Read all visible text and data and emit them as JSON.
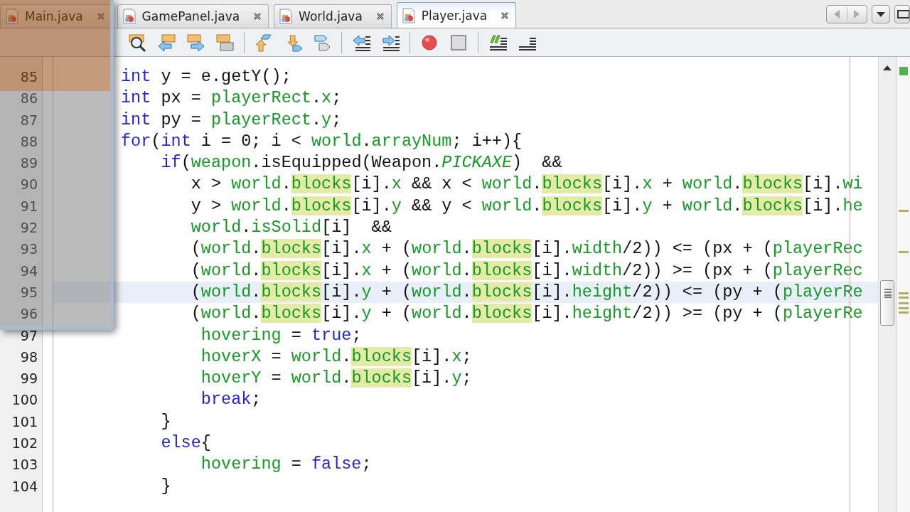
{
  "tabs": [
    {
      "label": "Main.java",
      "selected": false
    },
    {
      "label": "GamePanel.java",
      "selected": false
    },
    {
      "label": "World.java",
      "selected": false
    },
    {
      "label": "Player.java",
      "selected": true
    }
  ],
  "editor": {
    "lines": [
      {
        "number": "85",
        "current": false,
        "tokens": [
          {
            "kind": "keyword",
            "text": "int"
          },
          {
            "kind": "plain",
            "text": " y = e.getY();"
          }
        ]
      },
      {
        "number": "86",
        "current": false,
        "tokens": [
          {
            "kind": "keyword",
            "text": "int"
          },
          {
            "kind": "plain",
            "text": " px = "
          },
          {
            "kind": "field",
            "text": "playerRect"
          },
          {
            "kind": "plain",
            "text": "."
          },
          {
            "kind": "field",
            "text": "x"
          },
          {
            "kind": "plain",
            "text": ";"
          }
        ]
      },
      {
        "number": "87",
        "current": false,
        "tokens": [
          {
            "kind": "keyword",
            "text": "int"
          },
          {
            "kind": "plain",
            "text": " py = "
          },
          {
            "kind": "field",
            "text": "playerRect"
          },
          {
            "kind": "plain",
            "text": "."
          },
          {
            "kind": "field",
            "text": "y"
          },
          {
            "kind": "plain",
            "text": ";"
          }
        ]
      },
      {
        "number": "88",
        "current": false,
        "tokens": [
          {
            "kind": "keyword",
            "text": "for"
          },
          {
            "kind": "plain",
            "text": "("
          },
          {
            "kind": "keyword",
            "text": "int"
          },
          {
            "kind": "plain",
            "text": " i = 0; i < "
          },
          {
            "kind": "field",
            "text": "world"
          },
          {
            "kind": "plain",
            "text": "."
          },
          {
            "kind": "field",
            "text": "arrayNum"
          },
          {
            "kind": "plain",
            "text": "; i++){"
          }
        ]
      },
      {
        "number": "89",
        "current": false,
        "tokens": [
          {
            "kind": "keyword",
            "text": "    if"
          },
          {
            "kind": "plain",
            "text": "("
          },
          {
            "kind": "field",
            "text": "weapon"
          },
          {
            "kind": "plain",
            "text": ".isEquipped(Weapon."
          },
          {
            "kind": "constant",
            "text": "PICKAXE"
          },
          {
            "kind": "plain",
            "text": ")  &&"
          }
        ]
      },
      {
        "number": "90",
        "current": false,
        "tokens": [
          {
            "kind": "plain",
            "text": "       x > "
          },
          {
            "kind": "field",
            "text": "world"
          },
          {
            "kind": "plain",
            "text": "."
          },
          {
            "kind": "occurrence",
            "text": "blocks"
          },
          {
            "kind": "plain",
            "text": "[i]."
          },
          {
            "kind": "field",
            "text": "x"
          },
          {
            "kind": "plain",
            "text": " && x < "
          },
          {
            "kind": "field",
            "text": "world"
          },
          {
            "kind": "plain",
            "text": "."
          },
          {
            "kind": "occurrence",
            "text": "blocks"
          },
          {
            "kind": "plain",
            "text": "[i]."
          },
          {
            "kind": "field",
            "text": "x"
          },
          {
            "kind": "plain",
            "text": " + "
          },
          {
            "kind": "field",
            "text": "world"
          },
          {
            "kind": "plain",
            "text": "."
          },
          {
            "kind": "occurrence",
            "text": "blocks"
          },
          {
            "kind": "plain",
            "text": "[i]."
          },
          {
            "kind": "field",
            "text": "wi"
          }
        ]
      },
      {
        "number": "91",
        "current": false,
        "tokens": [
          {
            "kind": "plain",
            "text": "       y > "
          },
          {
            "kind": "field",
            "text": "world"
          },
          {
            "kind": "plain",
            "text": "."
          },
          {
            "kind": "occurrence",
            "text": "blocks"
          },
          {
            "kind": "plain",
            "text": "[i]."
          },
          {
            "kind": "field",
            "text": "y"
          },
          {
            "kind": "plain",
            "text": " && y < "
          },
          {
            "kind": "field",
            "text": "world"
          },
          {
            "kind": "plain",
            "text": "."
          },
          {
            "kind": "occurrence",
            "text": "blocks"
          },
          {
            "kind": "plain",
            "text": "[i]."
          },
          {
            "kind": "field",
            "text": "y"
          },
          {
            "kind": "plain",
            "text": " + "
          },
          {
            "kind": "field",
            "text": "world"
          },
          {
            "kind": "plain",
            "text": "."
          },
          {
            "kind": "occurrence",
            "text": "blocks"
          },
          {
            "kind": "plain",
            "text": "[i]."
          },
          {
            "kind": "field",
            "text": "he"
          }
        ]
      },
      {
        "number": "92",
        "current": false,
        "tokens": [
          {
            "kind": "field",
            "text": "       world"
          },
          {
            "kind": "plain",
            "text": "."
          },
          {
            "kind": "field",
            "text": "isSolid"
          },
          {
            "kind": "plain",
            "text": "[i]  &&"
          }
        ]
      },
      {
        "number": "93",
        "current": false,
        "tokens": [
          {
            "kind": "plain",
            "text": "       ("
          },
          {
            "kind": "field",
            "text": "world"
          },
          {
            "kind": "plain",
            "text": "."
          },
          {
            "kind": "occurrence",
            "text": "blocks"
          },
          {
            "kind": "plain",
            "text": "[i]."
          },
          {
            "kind": "field",
            "text": "x"
          },
          {
            "kind": "plain",
            "text": " + ("
          },
          {
            "kind": "field",
            "text": "world"
          },
          {
            "kind": "plain",
            "text": "."
          },
          {
            "kind": "occurrence",
            "text": "blocks"
          },
          {
            "kind": "plain",
            "text": "[i]."
          },
          {
            "kind": "field",
            "text": "width"
          },
          {
            "kind": "plain",
            "text": "/2)) <= (px + ("
          },
          {
            "kind": "field",
            "text": "playerRec"
          }
        ]
      },
      {
        "number": "94",
        "current": false,
        "tokens": [
          {
            "kind": "plain",
            "text": "       ("
          },
          {
            "kind": "field",
            "text": "world"
          },
          {
            "kind": "plain",
            "text": "."
          },
          {
            "kind": "occurrence",
            "text": "blocks"
          },
          {
            "kind": "plain",
            "text": "[i]."
          },
          {
            "kind": "field",
            "text": "x"
          },
          {
            "kind": "plain",
            "text": " + ("
          },
          {
            "kind": "field",
            "text": "world"
          },
          {
            "kind": "plain",
            "text": "."
          },
          {
            "kind": "occurrence",
            "text": "blocks"
          },
          {
            "kind": "plain",
            "text": "[i]."
          },
          {
            "kind": "field",
            "text": "width"
          },
          {
            "kind": "plain",
            "text": "/2)) >= (px + ("
          },
          {
            "kind": "field",
            "text": "playerRec"
          }
        ]
      },
      {
        "number": "95",
        "current": true,
        "tokens": [
          {
            "kind": "plain",
            "text": "       ("
          },
          {
            "kind": "field",
            "text": "world"
          },
          {
            "kind": "plain",
            "text": "."
          },
          {
            "kind": "occurrence",
            "text": "blocks"
          },
          {
            "kind": "plain",
            "text": "[i]."
          },
          {
            "kind": "field",
            "text": "y"
          },
          {
            "kind": "plain",
            "text": " + ("
          },
          {
            "kind": "field",
            "text": "world"
          },
          {
            "kind": "plain",
            "text": "."
          },
          {
            "kind": "occurrence",
            "text": "blocks"
          },
          {
            "kind": "plain",
            "text": "[i]."
          },
          {
            "kind": "field",
            "text": "height"
          },
          {
            "kind": "plain",
            "text": "/2)) <= (py + ("
          },
          {
            "kind": "field",
            "text": "playerRe"
          }
        ]
      },
      {
        "number": "96",
        "current": false,
        "tokens": [
          {
            "kind": "plain",
            "text": "       ("
          },
          {
            "kind": "field",
            "text": "world"
          },
          {
            "kind": "plain",
            "text": "."
          },
          {
            "kind": "occurrence",
            "text": "blocks"
          },
          {
            "kind": "plain",
            "text": "[i]."
          },
          {
            "kind": "field",
            "text": "y"
          },
          {
            "kind": "plain",
            "text": " + ("
          },
          {
            "kind": "field",
            "text": "world"
          },
          {
            "kind": "plain",
            "text": "."
          },
          {
            "kind": "occurrence",
            "text": "blocks"
          },
          {
            "kind": "plain",
            "text": "[i]."
          },
          {
            "kind": "field",
            "text": "height"
          },
          {
            "kind": "plain",
            "text": "/2)) >= (py + ("
          },
          {
            "kind": "field",
            "text": "playerRe"
          }
        ]
      },
      {
        "number": "97",
        "current": false,
        "tokens": [
          {
            "kind": "field",
            "text": "        hovering"
          },
          {
            "kind": "plain",
            "text": " = "
          },
          {
            "kind": "keyword",
            "text": "true"
          },
          {
            "kind": "plain",
            "text": ";"
          }
        ]
      },
      {
        "number": "98",
        "current": false,
        "tokens": [
          {
            "kind": "field",
            "text": "        hoverX"
          },
          {
            "kind": "plain",
            "text": " = "
          },
          {
            "kind": "field",
            "text": "world"
          },
          {
            "kind": "plain",
            "text": "."
          },
          {
            "kind": "occurrence",
            "text": "blocks"
          },
          {
            "kind": "plain",
            "text": "[i]."
          },
          {
            "kind": "field",
            "text": "x"
          },
          {
            "kind": "plain",
            "text": ";"
          }
        ]
      },
      {
        "number": "99",
        "current": false,
        "tokens": [
          {
            "kind": "field",
            "text": "        hoverY"
          },
          {
            "kind": "plain",
            "text": " = "
          },
          {
            "kind": "field",
            "text": "world"
          },
          {
            "kind": "plain",
            "text": "."
          },
          {
            "kind": "occurrence",
            "text": "blocks"
          },
          {
            "kind": "plain",
            "text": "[i]."
          },
          {
            "kind": "field",
            "text": "y"
          },
          {
            "kind": "plain",
            "text": ";"
          }
        ]
      },
      {
        "number": "100",
        "current": false,
        "tokens": [
          {
            "kind": "keyword",
            "text": "        break"
          },
          {
            "kind": "plain",
            "text": ";"
          }
        ]
      },
      {
        "number": "101",
        "current": false,
        "tokens": [
          {
            "kind": "plain",
            "text": "    }"
          }
        ]
      },
      {
        "number": "102",
        "current": false,
        "tokens": [
          {
            "kind": "keyword",
            "text": "    else"
          },
          {
            "kind": "plain",
            "text": "{"
          }
        ]
      },
      {
        "number": "103",
        "current": false,
        "tokens": [
          {
            "kind": "field",
            "text": "        hovering"
          },
          {
            "kind": "plain",
            "text": " = "
          },
          {
            "kind": "keyword",
            "text": "false"
          },
          {
            "kind": "plain",
            "text": ";"
          }
        ]
      },
      {
        "number": "104",
        "current": false,
        "tokens": [
          {
            "kind": "plain",
            "text": "    }"
          }
        ]
      }
    ]
  }
}
